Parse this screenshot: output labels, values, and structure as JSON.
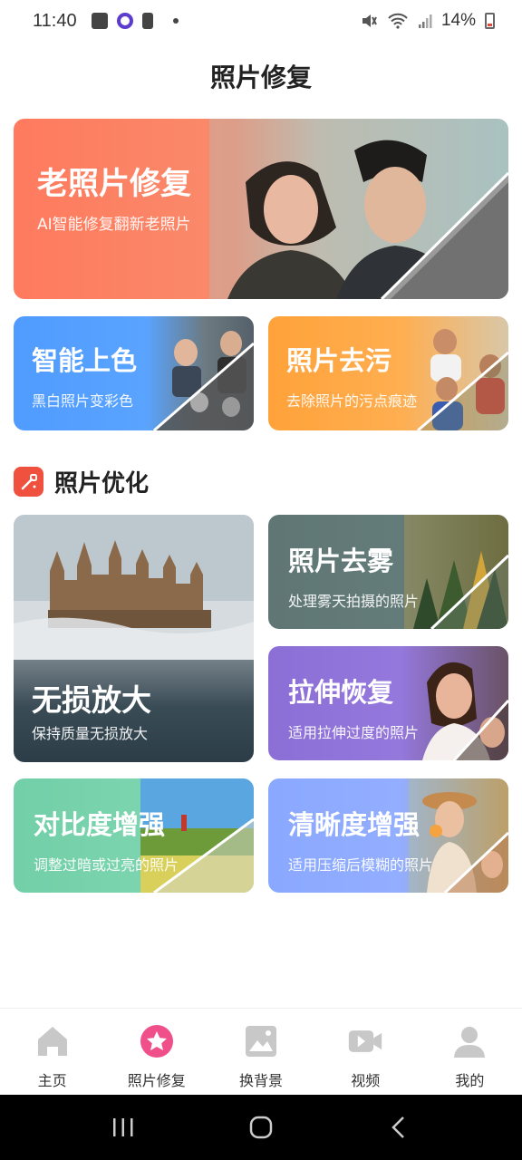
{
  "status_bar": {
    "time": "11:40",
    "battery": "14%"
  },
  "page": {
    "title": "照片修复"
  },
  "cards": {
    "hero": {
      "title": "老照片修复",
      "subtitle": "AI智能修复翻新老照片"
    },
    "colorize": {
      "title": "智能上色",
      "subtitle": "黑白照片变彩色"
    },
    "destain": {
      "title": "照片去污",
      "subtitle": "去除照片的污点痕迹"
    }
  },
  "section": {
    "title": "照片优化"
  },
  "optimize": {
    "upscale": {
      "title": "无损放大",
      "subtitle": "保持质量无损放大"
    },
    "dehaze": {
      "title": "照片去雾",
      "subtitle": "处理雾天拍摄的照片"
    },
    "stretch": {
      "title": "拉伸恢复",
      "subtitle": "适用拉伸过度的照片"
    },
    "contrast": {
      "title": "对比度增强",
      "subtitle": "调整过暗或过亮的照片"
    },
    "clarity": {
      "title": "清晰度增强",
      "subtitle": "适用压缩后模糊的照片"
    }
  },
  "nav": {
    "items": [
      {
        "label": "主页",
        "icon": "home-icon"
      },
      {
        "label": "照片修复",
        "icon": "star-icon",
        "active": true
      },
      {
        "label": "换背景",
        "icon": "image-icon"
      },
      {
        "label": "视频",
        "icon": "video-icon"
      },
      {
        "label": "我的",
        "icon": "user-icon"
      }
    ]
  },
  "colors": {
    "active": "#f0508a",
    "inactive": "#c8c8c8",
    "accent": "#f0503e"
  }
}
